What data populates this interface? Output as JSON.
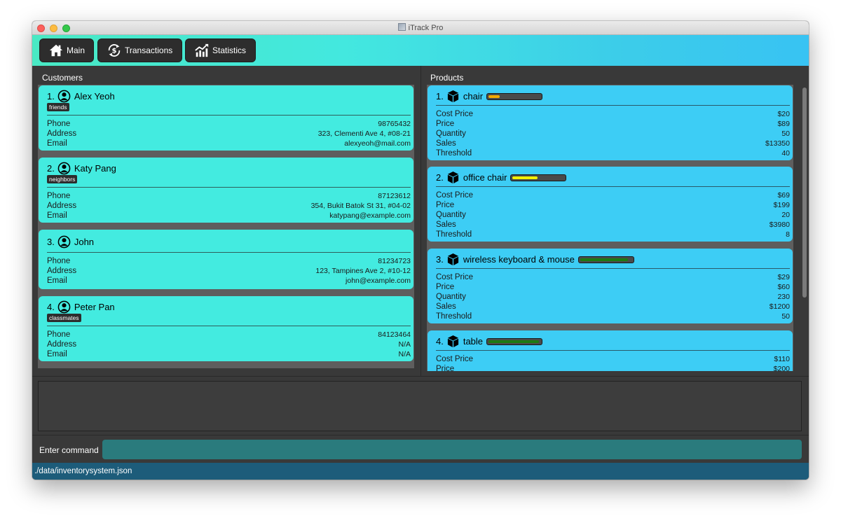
{
  "window": {
    "title": "iTrack Pro"
  },
  "toolbar": {
    "tabs": [
      {
        "label": "Main",
        "icon": "home-icon"
      },
      {
        "label": "Transactions",
        "icon": "money-exchange-icon"
      },
      {
        "label": "Statistics",
        "icon": "chart-icon"
      }
    ]
  },
  "customers": {
    "title": "Customers",
    "items": [
      {
        "index": "1.",
        "name": "Alex Yeoh",
        "tag": "friends",
        "phone": "98765432",
        "address": "323, Clementi Ave 4, #08-21",
        "email": "alexyeoh@mail.com"
      },
      {
        "index": "2.",
        "name": "Katy Pang",
        "tag": "neighbors",
        "phone": "87123612",
        "address": "354, Bukit Batok St 31, #04-02",
        "email": "katypang@example.com"
      },
      {
        "index": "3.",
        "name": "John",
        "tag": "",
        "phone": "81234723",
        "address": "123, Tampines Ave 2, #10-12",
        "email": "john@example.com"
      },
      {
        "index": "4.",
        "name": "Peter Pan",
        "tag": "classmates",
        "phone": "84123464",
        "address": "N/A",
        "email": "N/A"
      }
    ],
    "labels": {
      "phone": "Phone",
      "address": "Address",
      "email": "Email"
    }
  },
  "products": {
    "title": "Products",
    "labels": {
      "cost": "Cost Price",
      "price": "Price",
      "quantity": "Quantity",
      "sales": "Sales",
      "threshold": "Threshold"
    },
    "items": [
      {
        "index": "1.",
        "name": "chair",
        "cost": "$20",
        "price": "$89",
        "quantity": "50",
        "sales": "$13350",
        "threshold": "40",
        "stock_level": 0.22,
        "stock_color": "#f2a900"
      },
      {
        "index": "2.",
        "name": "office chair",
        "cost": "$69",
        "price": "$199",
        "quantity": "20",
        "sales": "$3980",
        "threshold": "8",
        "stock_level": 0.48,
        "stock_color": "#f4f000"
      },
      {
        "index": "3.",
        "name": "wireless keyboard & mouse",
        "cost": "$29",
        "price": "$60",
        "quantity": "230",
        "sales": "$1200",
        "threshold": "50",
        "stock_level": 0.92,
        "stock_color": "#1d7a12"
      },
      {
        "index": "4.",
        "name": "table",
        "cost": "$110",
        "price": "$200",
        "quantity": "",
        "sales": "",
        "threshold": "",
        "stock_level": 0.97,
        "stock_color": "#1d7a12"
      }
    ]
  },
  "command": {
    "label": "Enter command",
    "value": "",
    "placeholder": ""
  },
  "status": {
    "path": "./data/inventorysystem.json"
  }
}
